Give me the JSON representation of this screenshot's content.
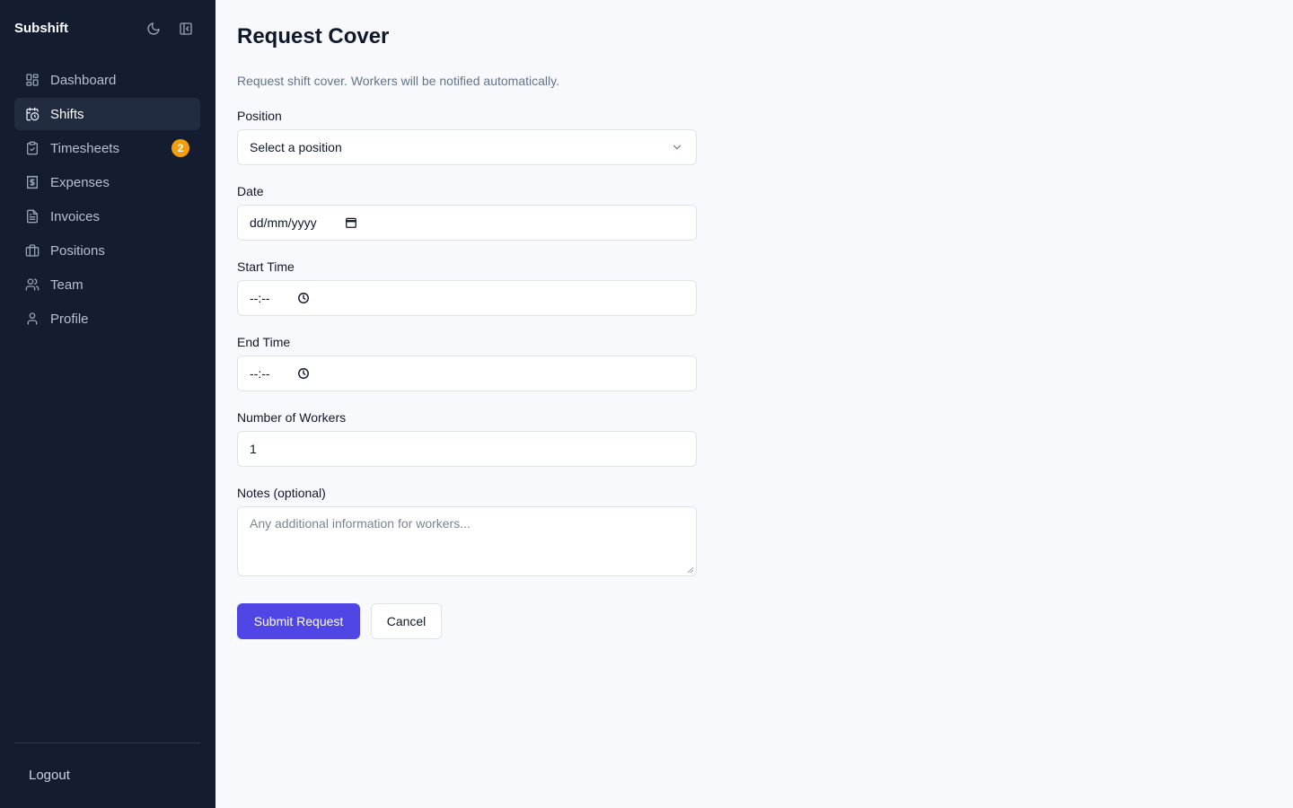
{
  "app": {
    "name": "Subshift"
  },
  "sidebar": {
    "header_icons": [
      "moon-icon",
      "sidebar-collapse-icon"
    ],
    "items": [
      {
        "label": "Dashboard",
        "icon": "dashboard-icon",
        "active": false
      },
      {
        "label": "Shifts",
        "icon": "calendar-clock-icon",
        "active": true
      },
      {
        "label": "Timesheets",
        "icon": "clipboard-check-icon",
        "active": false,
        "badge": "2"
      },
      {
        "label": "Expenses",
        "icon": "receipt-dollar-icon",
        "active": false
      },
      {
        "label": "Invoices",
        "icon": "file-text-icon",
        "active": false
      },
      {
        "label": "Positions",
        "icon": "briefcase-icon",
        "active": false
      },
      {
        "label": "Team",
        "icon": "users-icon",
        "active": false
      },
      {
        "label": "Profile",
        "icon": "user-icon",
        "active": false
      }
    ],
    "logout_label": "Logout"
  },
  "page": {
    "title": "Request Cover",
    "description": "Request shift cover. Workers will be notified automatically."
  },
  "form": {
    "position": {
      "label": "Position",
      "value": "Select a position"
    },
    "date": {
      "label": "Date",
      "value": "dd/mm/yyyy"
    },
    "start_time": {
      "label": "Start Time",
      "value": "--:--"
    },
    "end_time": {
      "label": "End Time",
      "value": "--:--"
    },
    "workers": {
      "label": "Number of Workers",
      "value": "1"
    },
    "notes": {
      "label": "Notes (optional)",
      "placeholder": "Any additional information for workers..."
    },
    "submit_label": "Submit Request",
    "cancel_label": "Cancel"
  },
  "colors": {
    "sidebar_bg": "#141c2f",
    "accent": "#4f46e5",
    "badge": "#f59e0b",
    "page_bg": "#f8f9fc"
  }
}
